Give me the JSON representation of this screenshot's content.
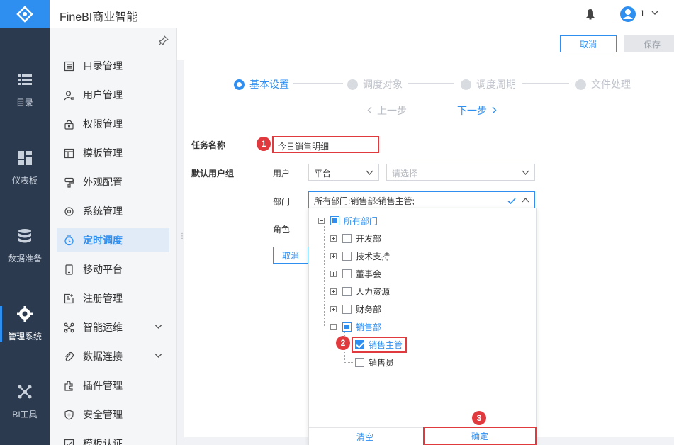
{
  "app": {
    "title": "FineBI商业智能",
    "user": "1"
  },
  "rail": [
    {
      "label": "目录",
      "icon": "list-icon"
    },
    {
      "label": "仪表板",
      "icon": "dashboard-icon"
    },
    {
      "label": "数据准备",
      "icon": "database-icon"
    },
    {
      "label": "管理系统",
      "icon": "gear-icon",
      "active": true
    },
    {
      "label": "BI工具",
      "icon": "tools-icon"
    }
  ],
  "nav": [
    {
      "label": "目录管理",
      "icon": "catalog-icon"
    },
    {
      "label": "用户管理",
      "icon": "user-icon"
    },
    {
      "label": "权限管理",
      "icon": "lock-icon"
    },
    {
      "label": "模板管理",
      "icon": "template-icon"
    },
    {
      "label": "外观配置",
      "icon": "brush-icon"
    },
    {
      "label": "系统管理",
      "icon": "settings-icon"
    },
    {
      "label": "定时调度",
      "icon": "clock-icon",
      "active": true
    },
    {
      "label": "移动平台",
      "icon": "mobile-icon"
    },
    {
      "label": "注册管理",
      "icon": "register-icon"
    },
    {
      "label": "智能运维",
      "icon": "ops-icon",
      "expandable": true
    },
    {
      "label": "数据连接",
      "icon": "link-icon",
      "expandable": true
    },
    {
      "label": "插件管理",
      "icon": "plugin-icon"
    },
    {
      "label": "安全管理",
      "icon": "shield-icon"
    },
    {
      "label": "模板认证",
      "icon": "cert-icon"
    }
  ],
  "actions": {
    "cancel": "取消",
    "save": "保存"
  },
  "steps": [
    "基本设置",
    "调度对象",
    "调度周期",
    "文件处理"
  ],
  "pager": {
    "prev": "上一步",
    "next": "下一步"
  },
  "form": {
    "task_name_label": "任务名称",
    "task_name_value": "今日销售明细",
    "default_group_label": "默认用户组",
    "user_label": "用户",
    "user_platform": "平台",
    "user_placeholder": "请选择",
    "dept_label": "部门",
    "dept_value": "所有部门:销售部:销售主管;",
    "role_label": "角色",
    "inner_cancel": "取消"
  },
  "tree": {
    "root": "所有部门",
    "children": [
      "开发部",
      "技术支持",
      "董事会",
      "人力资源",
      "财务部",
      "销售部"
    ],
    "sales_children": [
      "销售主管",
      "销售员"
    ]
  },
  "dropdown": {
    "clear": "清空",
    "ok": "确定"
  },
  "markers": [
    "1",
    "2",
    "3"
  ],
  "colors": {
    "accent": "#2f8ff0",
    "rail": "#2b3a4f",
    "highlight": "#e0393e"
  }
}
